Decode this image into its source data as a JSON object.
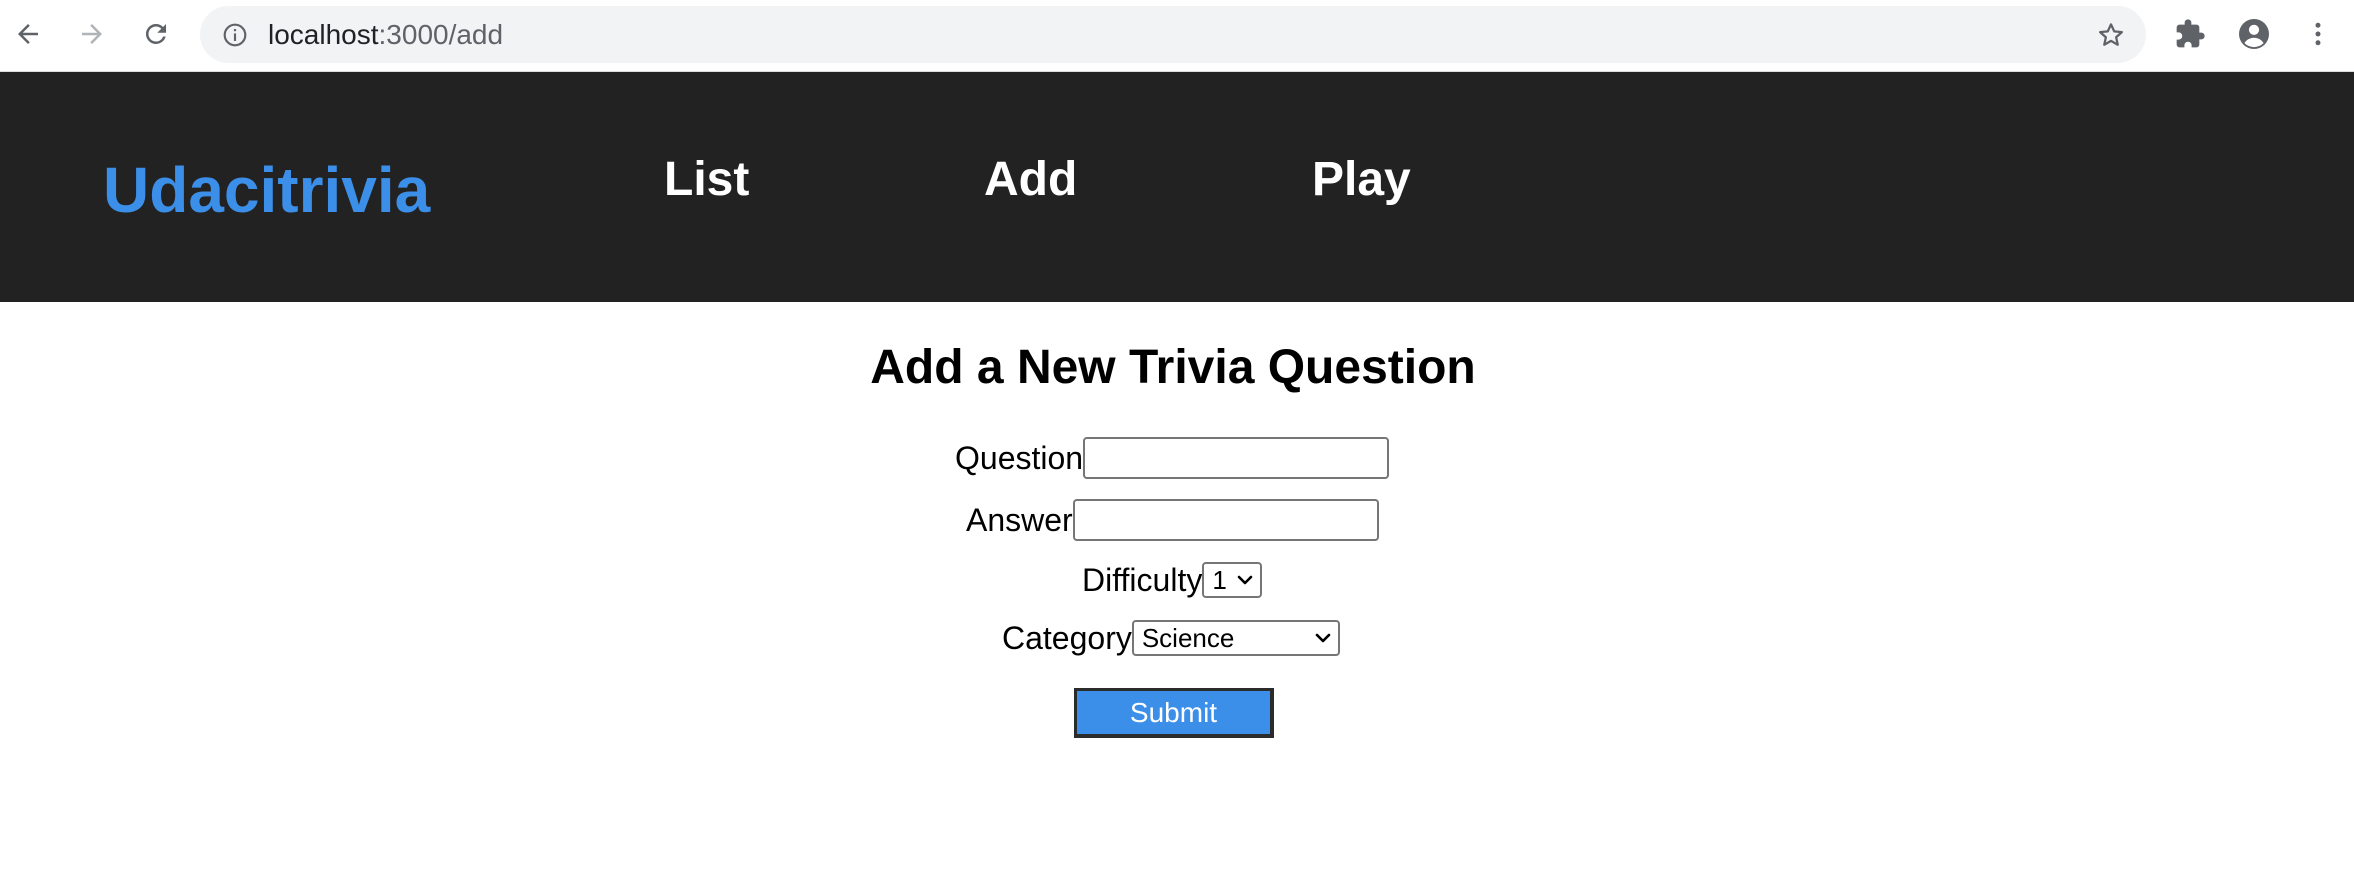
{
  "browser": {
    "url_host": "localhost",
    "url_path": ":3000/add",
    "icons": {
      "back": "arrow-left-icon",
      "forward": "arrow-right-icon",
      "reload": "reload-icon",
      "info": "info-icon",
      "bookmark": "star-icon",
      "extensions": "puzzle-icon",
      "profile": "account-icon",
      "menu": "kebab-menu-icon"
    }
  },
  "header": {
    "brand": "Udacitrivia",
    "nav": [
      {
        "label": "List"
      },
      {
        "label": "Add"
      },
      {
        "label": "Play"
      }
    ],
    "colors": {
      "background": "#222222",
      "brand": "#3c8fe8",
      "nav": "#ffffff"
    }
  },
  "form": {
    "title": "Add a New Trivia Question",
    "question_label": "Question",
    "question_value": "",
    "answer_label": "Answer",
    "answer_value": "",
    "difficulty_label": "Difficulty",
    "difficulty_value": "1",
    "category_label": "Category",
    "category_value": "Science",
    "submit_label": "Submit",
    "colors": {
      "submit": "#3c8fe8"
    }
  }
}
